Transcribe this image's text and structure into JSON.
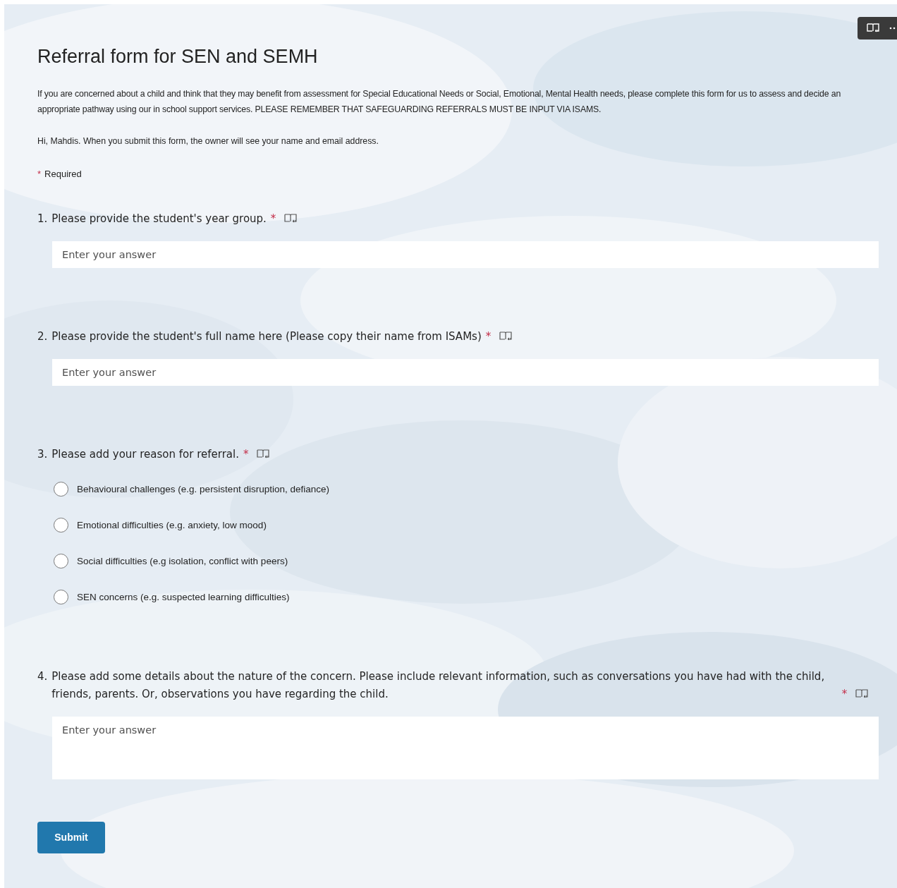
{
  "title": "Referral form for SEN and SEMH",
  "description": "If you are concerned about a child and think that they may benefit from assessment for Special Educational Needs or Social, Emotional, Mental Health needs, please complete this form for us to assess and decide an appropriate pathway using our in school support services. PLEASE REMEMBER THAT SAFEGUARDING REFERRALS MUST BE INPUT VIA ISAMS.",
  "greeting": "Hi, Mahdis. When you submit this form, the owner will see your name and email address.",
  "required_note": {
    "mark": "*",
    "label": "Required"
  },
  "questions": [
    {
      "kind": "text",
      "number": "1.",
      "text": "Please provide the student's year group.",
      "required": true,
      "placeholder": "Enter your answer"
    },
    {
      "kind": "text",
      "number": "2.",
      "text": "Please provide the student's full name here (Please copy their name from ISAMs)",
      "required": true,
      "placeholder": "Enter your answer"
    },
    {
      "kind": "choice",
      "number": "3.",
      "text": "Please add your reason for referral.",
      "required": true,
      "options": [
        {
          "label": "Behavioural challenges (e.g. persistent disruption, defiance)",
          "selected": false
        },
        {
          "label": "Emotional difficulties (e.g. anxiety, low mood)",
          "selected": false
        },
        {
          "label": "Social difficulties (e.g isolation, conflict with peers)",
          "selected": false
        },
        {
          "label": "SEN concerns (e.g. suspected learning difficulties)",
          "selected": false
        }
      ]
    },
    {
      "kind": "long",
      "number": "4.",
      "text": "Please add some details about the nature of the concern. Please include relevant information, such as conversations you have had with the child, friends, parents. Or, observations you have regarding the child.",
      "required": true,
      "placeholder": "Enter your answer"
    }
  ],
  "submit": "Submit"
}
